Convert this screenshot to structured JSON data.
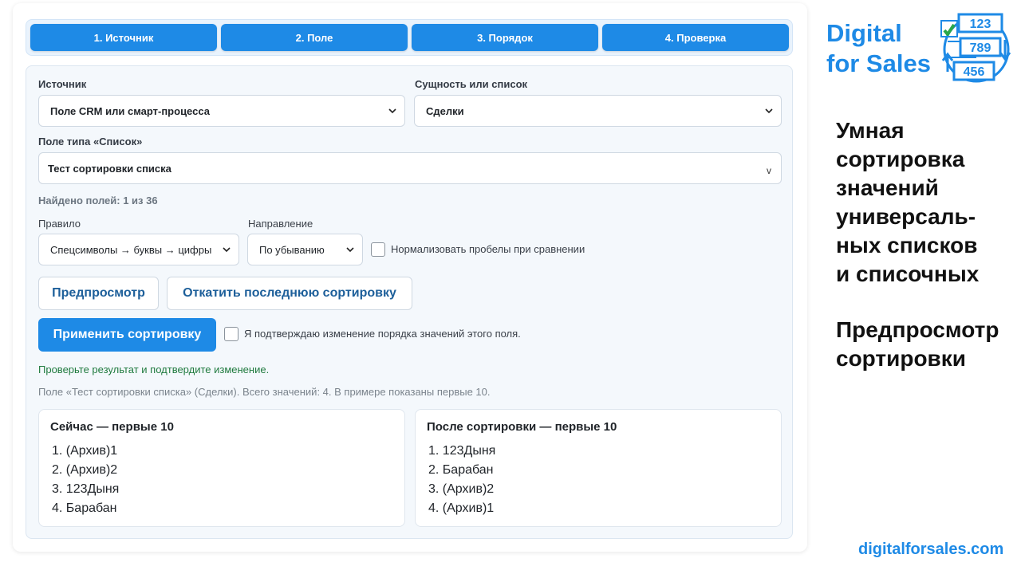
{
  "steps": [
    "1. Источник",
    "2. Поле",
    "3. Порядок",
    "4. Проверка"
  ],
  "form": {
    "source_label": "Источник",
    "source_value": "Поле CRM или смарт-процесса",
    "entity_label": "Сущность или список",
    "entity_value": "Сделки",
    "field_label": "Поле типа «Список»",
    "field_value": "Тест сортировки списка",
    "field_caret": "v",
    "found_text": "Найдено полей: 1 из 36",
    "rule_label": "Правило",
    "rule_value": "Спецсимволы → буквы → цифры",
    "direction_label": "Направление",
    "direction_value": "По убыванию",
    "normalize_label": "Нормализовать пробелы при сравнении"
  },
  "actions": {
    "preview": "Предпросмотр",
    "rollback": "Откатить последнюю сортировку",
    "apply": "Применить сортировку",
    "confirm_label": "Я подтверждаю изменение порядка значений этого поля."
  },
  "messages": {
    "check": "Проверьте результат и подтвердите изменение.",
    "info": "Поле «Тест сортировки списка» (Сделки). Всего значений: 4. В примере показаны первые 10."
  },
  "lists": {
    "current": {
      "title": "Сейчас — первые 10",
      "items": [
        "1. (Архив)1",
        "2. (Архив)2",
        "3. 123Дыня",
        "4. Барабан"
      ]
    },
    "after": {
      "title": "После сортировки — первые 10",
      "items": [
        "1. 123Дыня",
        "2. Барабан",
        "3. (Архив)2",
        "4. (Архив)1"
      ]
    }
  },
  "brand": {
    "line1": "Digital",
    "line2": "for Sales",
    "logo_numbers": [
      "123",
      "789",
      "456"
    ],
    "headline": [
      "Умная",
      "сортировка",
      "значений",
      "универсаль-",
      "ных списков",
      "и списочных"
    ],
    "subheadline": [
      "Предпросмотр",
      "сортировки"
    ],
    "url": "digitalforsales.com",
    "accent_color": "#1e8ae6",
    "check_color": "#2aa84a"
  }
}
